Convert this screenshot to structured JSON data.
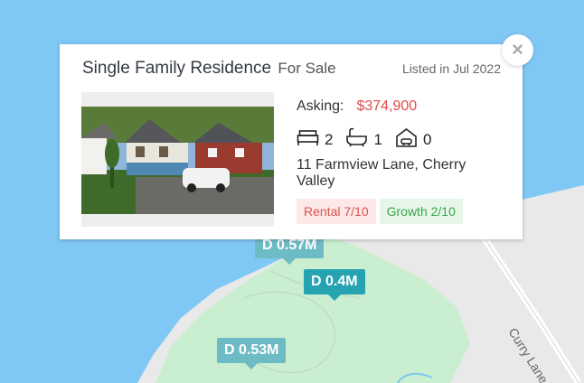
{
  "map": {
    "markers": [
      {
        "label": "D 0.57M"
      },
      {
        "label": "D 0.4M"
      },
      {
        "label": "D 0.53M"
      }
    ],
    "road_label": "Curry Lane"
  },
  "popup": {
    "title": "Single Family Residence",
    "status": "For Sale",
    "listed": "Listed in Jul 2022",
    "asking_label": "Asking:",
    "price": "$374,900",
    "beds": "2",
    "baths": "1",
    "garage": "0",
    "address": "11 Farmview Lane, Cherry Valley",
    "rental_tag": "Rental 7/10",
    "growth_tag": "Growth 2/10",
    "close_symbol": "×"
  },
  "icons": [
    "bed-icon",
    "bathtub-icon",
    "garage-car-icon",
    "close-icon"
  ],
  "colors": {
    "water": "#7fc8f5",
    "land": "#e9e9e9",
    "park": "#c9eed0",
    "price": "#e24a4a",
    "marker_dark": "#25a3b1",
    "marker_light": "#6dbbc5"
  }
}
